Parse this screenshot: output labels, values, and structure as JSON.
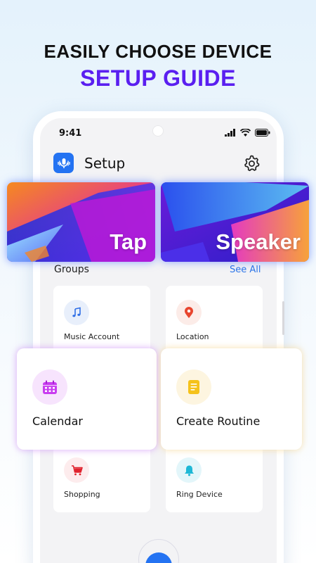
{
  "promo": {
    "line1": "EASILY CHOOSE DEVICE",
    "line2": "SETUP GUIDE"
  },
  "status_bar": {
    "time": "9:41",
    "icons": [
      "signal-icon",
      "wifi-icon",
      "battery-icon"
    ]
  },
  "header": {
    "app_icon": "voice-assistant-icon",
    "title": "Setup",
    "settings_icon": "gear-icon"
  },
  "banners": [
    {
      "label": "Tap"
    },
    {
      "label": "Speaker"
    }
  ],
  "groups": {
    "title": "Groups",
    "see_all": "See All",
    "items": [
      {
        "label": "Music Account",
        "icon": "music-note-icon",
        "color": "#2f6fe6"
      },
      {
        "label": "Location",
        "icon": "location-pin-icon",
        "color": "#e8452e"
      },
      {
        "label": "Calendar",
        "icon": "calendar-icon",
        "color": "#c93cf0"
      },
      {
        "label": "Create Routine",
        "icon": "document-icon",
        "color": "#f5c21a"
      },
      {
        "label": "Shopping",
        "icon": "shopping-cart-icon",
        "color": "#e0232e"
      },
      {
        "label": "Ring Device",
        "icon": "bell-icon",
        "color": "#1eb8d6"
      }
    ]
  },
  "colors": {
    "accent": "#5a1ff0",
    "primary": "#2473f2",
    "link": "#2b74e8"
  }
}
